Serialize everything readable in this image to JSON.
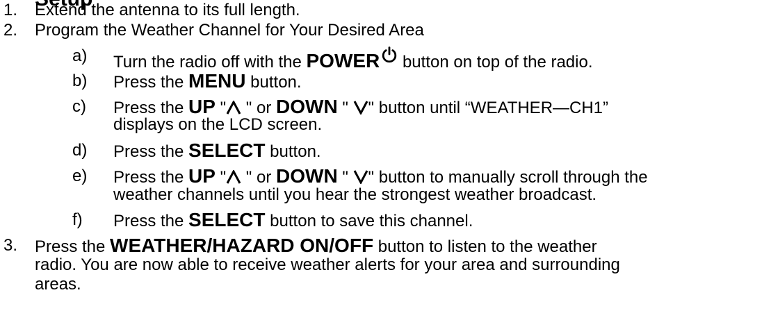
{
  "heading_fragment": "Setup",
  "steps": [
    {
      "num": "1.",
      "text": "Extend the antenna to its full length."
    },
    {
      "num": "2.",
      "text": "Program the Weather Channel for Your Desired Area"
    },
    {
      "num": "3.",
      "pre": "Press the ",
      "bold": "WEATHER/HAZARD ON/OFF",
      "post": " button to listen to the weather",
      "cont1": "radio. You are now able to receive weather alerts for your area and surrounding",
      "cont2": "areas."
    }
  ],
  "substeps": {
    "a": {
      "label": "a)",
      "pre": "Turn the radio off with the ",
      "bold": "POWER",
      "post": " button on top of the radio."
    },
    "b": {
      "label": "b)",
      "pre": "Press the ",
      "bold": "MENU",
      "post": " button."
    },
    "c": {
      "label": "c)",
      "pre": "Press the ",
      "bold_up": "UP",
      "q1": " \"",
      "q2": " \" or ",
      "bold_down": "DOWN",
      "q3": " \" ",
      "post": "\" button until “WEATHER—CH1”",
      "cont": "displays on the LCD screen."
    },
    "d": {
      "label": "d)",
      "pre": "Press the ",
      "bold": "SELECT",
      "post": " button."
    },
    "e": {
      "label": "e)",
      "pre": "Press the ",
      "bold_up": "UP",
      "q1": " \"",
      "q2": " \" or ",
      "bold_down": "DOWN",
      "q3": " \" ",
      "post": "\" button to manually scroll through the",
      "cont": "weather channels until you hear the strongest weather broadcast."
    },
    "f": {
      "label": "f)",
      "pre": "Press the ",
      "bold": "SELECT",
      "post": " button to save this channel."
    }
  },
  "icons": {
    "power": "power-icon",
    "up": "up-arrow-icon",
    "down": "down-arrow-icon"
  }
}
